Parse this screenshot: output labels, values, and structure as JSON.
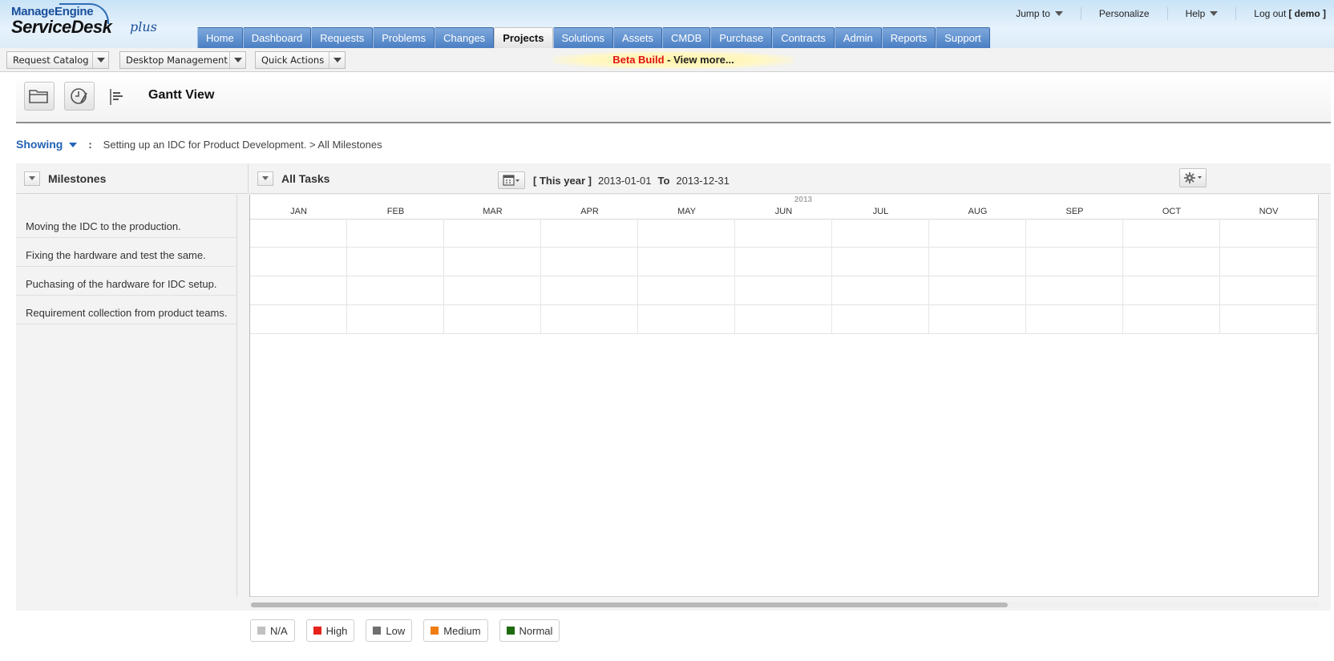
{
  "brand": {
    "company": "ManageEngine",
    "product": "ServiceDesk",
    "edition": "plus"
  },
  "toplinks": {
    "jump_to": "Jump to",
    "personalize": "Personalize",
    "help": "Help",
    "logout": "Log out",
    "user": "[ demo ]"
  },
  "tabs": [
    {
      "label": "Home"
    },
    {
      "label": "Dashboard"
    },
    {
      "label": "Requests"
    },
    {
      "label": "Problems"
    },
    {
      "label": "Changes"
    },
    {
      "label": "Projects",
      "active": true
    },
    {
      "label": "Solutions"
    },
    {
      "label": "Assets"
    },
    {
      "label": "CMDB"
    },
    {
      "label": "Purchase"
    },
    {
      "label": "Contracts"
    },
    {
      "label": "Admin"
    },
    {
      "label": "Reports"
    },
    {
      "label": "Support"
    }
  ],
  "subbar": {
    "request_catalog": "Request Catalog",
    "desktop_management": "Desktop Management",
    "quick_actions": "Quick Actions",
    "beta_red": "Beta Build",
    "beta_rest": " - View more..."
  },
  "page": {
    "title": "Gantt View"
  },
  "showing": {
    "label": "Showing",
    "colon": ":",
    "breadcrumb": "Setting up an IDC for Product Development. >  All Milestones"
  },
  "gantt": {
    "left_header": "Milestones",
    "right_header": "All Tasks",
    "range_label": "[ This year ]",
    "from_date": "2013-01-01",
    "to_label": "To",
    "to_date": "2013-12-31",
    "year": "2013",
    "months": [
      "JAN",
      "FEB",
      "MAR",
      "APR",
      "MAY",
      "JUN",
      "JUL",
      "AUG",
      "SEP",
      "OCT",
      "NOV"
    ],
    "milestones": [
      "Moving the IDC to the production.",
      "Fixing the hardware and test the same.",
      "Puchasing of the hardware for IDC setup.",
      "Requirement collection from product teams."
    ]
  },
  "legend": [
    {
      "label": "N/A",
      "color": "#c0c0c0"
    },
    {
      "label": "High",
      "color": "#e8231b"
    },
    {
      "label": "Low",
      "color": "#6f6f6f"
    },
    {
      "label": "Medium",
      "color": "#f07d12"
    },
    {
      "label": "Normal",
      "color": "#1f6b12"
    }
  ],
  "scrollbar": {
    "position": 0,
    "visible_fraction": 0.71
  }
}
